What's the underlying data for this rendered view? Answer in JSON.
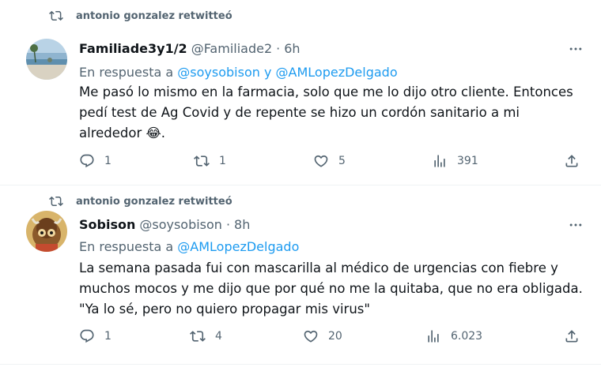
{
  "tweets": [
    {
      "retweet_label": "antonio gonzalez retwitteó",
      "name": "Familiade3y1/2",
      "handle": "@Familiade2",
      "time": "6h",
      "reply_prefix": "En respuesta a",
      "reply_mention_1": "@soysobison",
      "reply_join": "y",
      "reply_mention_2": "@AMLopezDelgado",
      "text": "Me pasó lo mismo en la farmacia, solo que me lo dijo otro cliente. Entonces pedí test de Ag Covid y de repente se hizo un cordón sanitario a mi alrededor",
      "emoji": "😂",
      "emoji_suffix": ".",
      "replies": "1",
      "retweets": "1",
      "likes": "5",
      "views": "391",
      "avatar_icon": "beach-photo"
    },
    {
      "retweet_label": "antonio gonzalez retwitteó",
      "name": "Sobison",
      "handle": "@soysobison",
      "time": "8h",
      "reply_prefix": "En respuesta a",
      "reply_mention_1": "@AMLopezDelgado",
      "text": "La semana pasada fui con mascarilla al médico de urgencias con fiebre y muchos mocos y me dijo que por qué no me la quitaba, que no era obligada. \"Ya lo sé, pero no quiero propagar mis virus\"",
      "replies": "1",
      "retweets": "4",
      "likes": "20",
      "views": "6.023",
      "avatar_icon": "bison-cartoon"
    }
  ],
  "colors": {
    "accent": "#1d9bf0",
    "secondary_text": "#536471",
    "primary_text": "#0f1419"
  },
  "icons": [
    "retweet-icon",
    "more-icon",
    "reply-icon",
    "like-icon",
    "views-icon",
    "share-icon"
  ]
}
